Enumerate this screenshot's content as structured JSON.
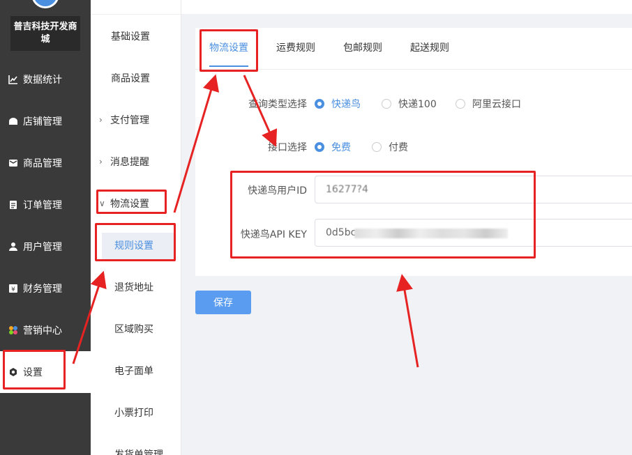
{
  "brand": {
    "name": "普吉科技开发商城"
  },
  "sidebar": {
    "items": [
      {
        "label": "数据统计",
        "icon": "line-chart-icon"
      },
      {
        "label": "店铺管理",
        "icon": "shop-icon"
      },
      {
        "label": "商品管理",
        "icon": "envelope-icon"
      },
      {
        "label": "订单管理",
        "icon": "clipboard-icon"
      },
      {
        "label": "用户管理",
        "icon": "user-icon"
      },
      {
        "label": "财务管理",
        "icon": "yen-icon"
      },
      {
        "label": "营销中心",
        "icon": "colorful-dots-icon"
      },
      {
        "label": "设置",
        "icon": "gear-icon"
      }
    ]
  },
  "submenu": {
    "items": [
      {
        "label": "基础设置"
      },
      {
        "label": "商品设置"
      },
      {
        "label": "支付管理",
        "expandable": true
      },
      {
        "label": "消息提醒",
        "expandable": true
      },
      {
        "label": "物流设置",
        "expanded": true
      },
      {
        "label": "规则设置",
        "selected": true
      },
      {
        "label": "退货地址"
      },
      {
        "label": "区域购买"
      },
      {
        "label": "电子面单"
      },
      {
        "label": "小票打印"
      },
      {
        "label": "发货单管理"
      }
    ]
  },
  "tabs": [
    {
      "label": "物流设置",
      "active": true
    },
    {
      "label": "运费规则"
    },
    {
      "label": "包邮规则"
    },
    {
      "label": "起送规则"
    }
  ],
  "form": {
    "query_type": {
      "label": "查询类型选择",
      "options": [
        "快递鸟",
        "快递100",
        "阿里云接口"
      ],
      "selected": "快递鸟"
    },
    "interface": {
      "label": "接口选择",
      "options": [
        "免费",
        "付费"
      ],
      "selected": "免费"
    },
    "user_id": {
      "label": "快递鸟用户ID",
      "value": "16277?4"
    },
    "api_key": {
      "label": "快递鸟API KEY",
      "value": "0d5bc"
    }
  },
  "save_label": "保存",
  "colors": {
    "accent": "#4a8fe0",
    "sidebar_bg": "#3a3a3a",
    "annotation": "#e62222"
  }
}
